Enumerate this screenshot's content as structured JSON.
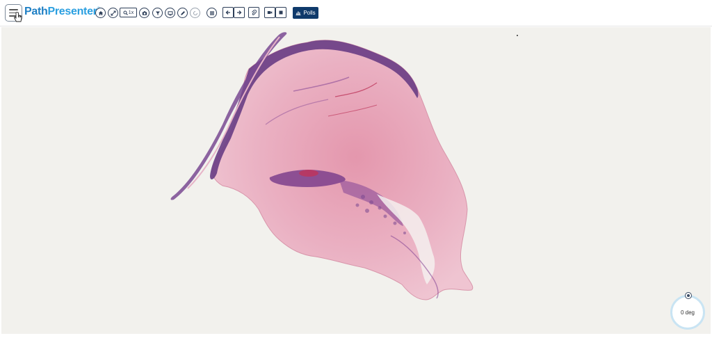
{
  "app": {
    "logo_part1": "Path",
    "logo_part2": "Presenter",
    "logo_mark": "®"
  },
  "toolbar": {
    "menu_icon": "hamburger-menu-icon",
    "buttons": [
      {
        "name": "home",
        "icon": "home-icon",
        "glyph": "⌂"
      },
      {
        "name": "fullscreen",
        "icon": "expand-icon",
        "glyph": "⤢"
      },
      {
        "name": "camera",
        "icon": "camera-icon",
        "glyph": "◉"
      },
      {
        "name": "filter",
        "icon": "filter-icon",
        "glyph": "▼"
      },
      {
        "name": "screen",
        "icon": "monitor-icon",
        "glyph": "▭"
      },
      {
        "name": "annotate",
        "icon": "pencil-icon",
        "glyph": "✎"
      },
      {
        "name": "rotate",
        "icon": "rotate-icon",
        "glyph": "↻"
      },
      {
        "name": "list",
        "icon": "list-icon",
        "glyph": "☰"
      },
      {
        "name": "back",
        "icon": "arrow-left-icon",
        "glyph": "←"
      },
      {
        "name": "forward",
        "icon": "arrow-right-icon",
        "glyph": "→"
      },
      {
        "name": "attach",
        "icon": "paperclip-icon",
        "glyph": "✎"
      },
      {
        "name": "video",
        "icon": "video-icon",
        "glyph": "■"
      },
      {
        "name": "stop",
        "icon": "stop-icon",
        "glyph": "■"
      }
    ],
    "zoom_label": "1x",
    "zoom_icon": "magnifier-icon",
    "polls_label": "Polls",
    "polls_icon": "bar-chart-icon"
  },
  "viewer": {
    "rotation_label": "0 deg"
  },
  "colors": {
    "brand_dark": "#1e7fc4",
    "brand_light": "#2a9fe0",
    "toolbar_icon": "#2d3e58",
    "polls_bg": "#0f3a6b",
    "slide_bg": "#f2f1ed",
    "tissue_pink": "#e8a9bd",
    "tissue_purple": "#6b3f86"
  }
}
